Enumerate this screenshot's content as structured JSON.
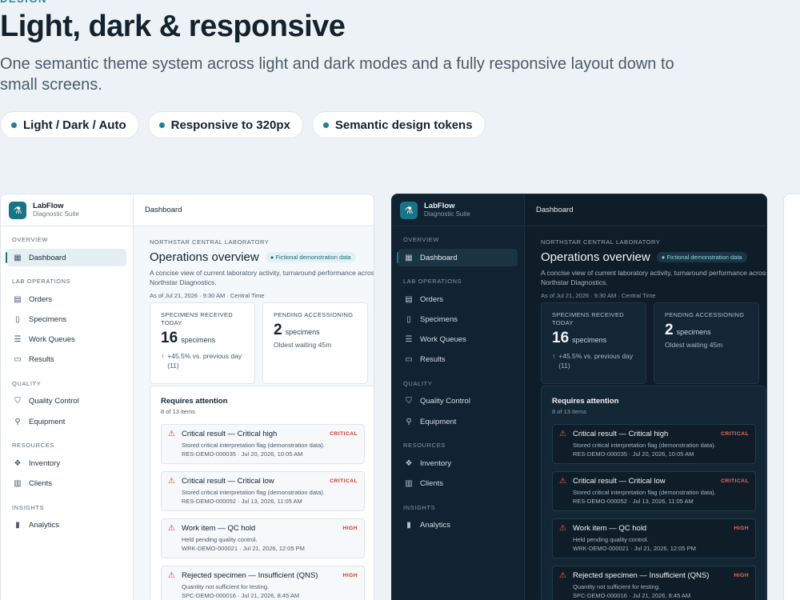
{
  "hero": {
    "title": "Light, dark & responsive",
    "subtitle": "One semantic theme system across light and dark modes and a fully responsive layout down to small screens.",
    "chips": [
      "Light / Dark / Auto",
      "Responsive to 320px",
      "Semantic design tokens"
    ]
  },
  "colors": {
    "accent": "#1a7487",
    "critical": "#c53a32",
    "dark_bg": "#0f1d28"
  },
  "app": {
    "brand": {
      "name": "LabFlow",
      "subtitle": "Diagnostic Suite",
      "icon": "flask-icon"
    },
    "topbar": {
      "title": "Dashboard"
    },
    "nav": {
      "sections": [
        {
          "label": "OVERVIEW",
          "items": [
            {
              "label": "Dashboard",
              "icon": "dashboard-grid-icon"
            }
          ]
        },
        {
          "label": "LAB OPERATIONS",
          "items": [
            {
              "label": "Orders",
              "icon": "clipboard-icon"
            },
            {
              "label": "Specimens",
              "icon": "test-tubes-icon"
            },
            {
              "label": "Work Queues",
              "icon": "checklist-icon"
            },
            {
              "label": "Results",
              "icon": "document-icon"
            }
          ]
        },
        {
          "label": "QUALITY",
          "items": [
            {
              "label": "Quality Control",
              "icon": "shield-check-icon"
            },
            {
              "label": "Equipment",
              "icon": "microscope-icon"
            }
          ]
        },
        {
          "label": "RESOURCES",
          "items": [
            {
              "label": "Inventory",
              "icon": "boxes-icon"
            },
            {
              "label": "Clients",
              "icon": "building-icon"
            }
          ]
        },
        {
          "label": "INSIGHTS",
          "items": [
            {
              "label": "Analytics",
              "icon": "bar-chart-icon"
            }
          ]
        }
      ]
    },
    "dashboard": {
      "lab_name": "NORTHSTAR CENTRAL LABORATORY",
      "title": "Operations overview",
      "demo_badge": "Fictional demonstration data",
      "description": "A concise view of current laboratory activity, turnaround performance across Northstar Diagnostics.",
      "as_of": "As of  Jul 21, 2026  ·  9:30 AM  ·  Central Time",
      "stats": [
        {
          "label": "SPECIMENS RECEIVED TODAY",
          "value": "16",
          "unit": "specimens",
          "note": "+45.5% vs. previous day (11)"
        },
        {
          "label": "PENDING ACCESSIONING",
          "value": "2",
          "unit": "specimens",
          "note": "Oldest waiting 45m"
        }
      ],
      "attention": {
        "title": "Requires attention",
        "count": "8 of 13 items",
        "items": [
          {
            "title": "Critical result — Critical high",
            "severity": "CRITICAL",
            "body": "Stored critical interpretation flag (demonstration data).",
            "meta": "RES-DEMO-000035  ·  Jul 20, 2026, 10:05 AM"
          },
          {
            "title": "Critical result — Critical low",
            "severity": "CRITICAL",
            "body": "Stored critical interpretation flag (demonstration data).",
            "meta": "RES-DEMO-000052  ·  Jul 13, 2026, 11:05 AM"
          },
          {
            "title": "Work item — QC hold",
            "severity": "HIGH",
            "body": "Held pending quality control.",
            "meta": "WRK-DEMO-000021  ·  Jul 21, 2026, 12:05 PM"
          },
          {
            "title": "Rejected specimen — Insufficient (QNS)",
            "severity": "HIGH",
            "body": "Quantity not sufficient for testing.",
            "meta": "SPC-DEMO-000016  ·  Jul 21, 2026, 8:45 AM"
          }
        ]
      }
    }
  }
}
